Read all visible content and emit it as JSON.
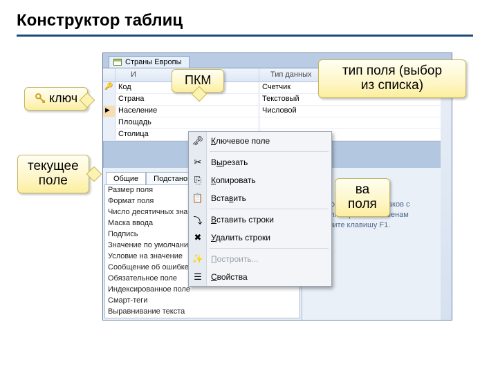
{
  "slide_title": "Конструктор таблиц",
  "tab_name": "Страны Европы",
  "grid": {
    "head_colA": "И",
    "head_colB": "Тип данных",
    "rows": [
      {
        "name": "Код",
        "type": "Счетчик",
        "key": true,
        "current": false
      },
      {
        "name": "Страна",
        "type": "Текстовый",
        "key": false,
        "current": false
      },
      {
        "name": "Население",
        "type": "Числовой",
        "key": false,
        "current": true
      },
      {
        "name": "Площадь",
        "type": "",
        "key": false,
        "current": false
      },
      {
        "name": "Столица",
        "type": "",
        "key": false,
        "current": false
      }
    ]
  },
  "props": {
    "tab_general": "Общие",
    "tab_lookup": "Подстанов",
    "labels": [
      "Размер поля",
      "Формат поля",
      "Число десятичных знако",
      "Маска ввода",
      "Подпись",
      "Значение по умолчани",
      "Условие на значение",
      "Сообщение об ошибке",
      "Обязательное поле",
      "Индексированное поле",
      "Смарт-теги",
      "Выравнивание текста"
    ],
    "help_text": "ожет состоять из 64 знаков с\nлов. Для справки по именам\n   и нажмите клавишу F1."
  },
  "context_menu": [
    {
      "label": "Ключевое поле",
      "icon": "key-icon",
      "u": 0,
      "disabled": false
    },
    {
      "sep": true
    },
    {
      "label": "Вырезать",
      "icon": "cut-icon",
      "u": 1,
      "disabled": false
    },
    {
      "label": "Копировать",
      "icon": "copy-icon",
      "u": 0,
      "disabled": false
    },
    {
      "label": "Вставить",
      "icon": "paste-icon",
      "u": 4,
      "disabled": false
    },
    {
      "sep": true
    },
    {
      "label": "Вставить строки",
      "icon": "insert-rows-icon",
      "u": 0,
      "disabled": false
    },
    {
      "label": "Удалить строки",
      "icon": "delete-rows-icon",
      "u": 0,
      "disabled": false
    },
    {
      "sep": true
    },
    {
      "label": "Построить...",
      "icon": "build-icon",
      "u": 0,
      "disabled": true
    },
    {
      "label": "Свойства",
      "icon": "props-icon",
      "u": 0,
      "disabled": false
    }
  ],
  "callouts": {
    "key": "ключ",
    "pkm": "ПКМ",
    "type": "тип поля (выбор\nиз списка)",
    "current": "текущее\nполе",
    "sva_tail": "ва\nполя"
  }
}
